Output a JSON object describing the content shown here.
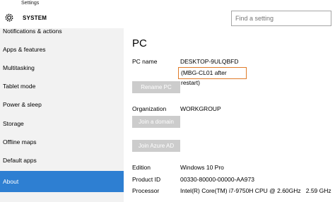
{
  "window": {
    "title": "Settings"
  },
  "header": {
    "section_label": "SYSTEM",
    "search_placeholder": "Find a setting"
  },
  "sidebar": {
    "items": [
      {
        "label": "Notifications & actions"
      },
      {
        "label": "Apps & features"
      },
      {
        "label": "Multitasking"
      },
      {
        "label": "Tablet mode"
      },
      {
        "label": "Power & sleep"
      },
      {
        "label": "Storage"
      },
      {
        "label": "Offline maps"
      },
      {
        "label": "Default apps"
      },
      {
        "label": "About"
      }
    ],
    "active_index": 8
  },
  "main": {
    "title": "PC",
    "pc_name_label": "PC name",
    "pc_name_value": "DESKTOP-9ULQBFD",
    "pc_name_annotation": "(MBG-CL01 after restart)",
    "rename_button": "Rename PC",
    "organization_label": "Organization",
    "organization_value": "WORKGROUP",
    "join_domain_button": "Join a domain",
    "join_azure_button": "Join Azure AD",
    "specs": [
      {
        "label": "Edition",
        "value": "Windows 10 Pro"
      },
      {
        "label": "Product ID",
        "value": "00330-80000-00000-AA973"
      },
      {
        "label": "Processor",
        "value": "Intel(R) Core(TM) i7-9750H CPU @ 2.60GHz   2.59 GHz"
      }
    ]
  },
  "colors": {
    "accent": "#2e7fd2",
    "annotation_border": "#e07b29",
    "sidebar_bg": "#f2f2f2",
    "disabled_button": "#cccccc"
  }
}
